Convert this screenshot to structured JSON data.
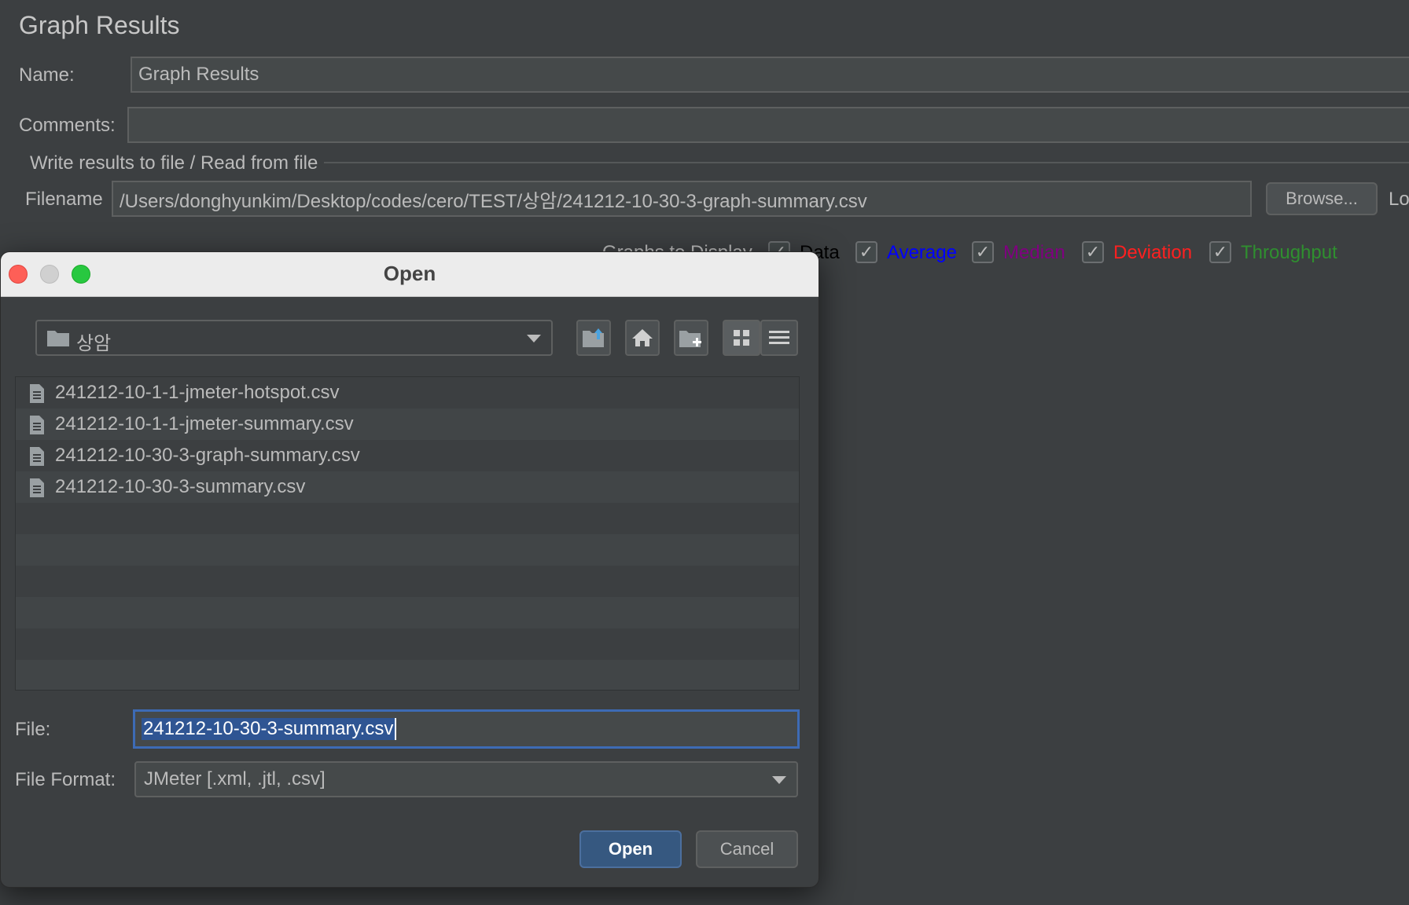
{
  "panel": {
    "title": "Graph Results",
    "name_label": "Name:",
    "name_value": "Graph Results",
    "comments_label": "Comments:",
    "comments_value": "",
    "group_title": "Write results to file / Read from file",
    "filename_label": "Filename",
    "filename_value": "/Users/donghyunkim/Desktop/codes/cero/TEST/상암/241212-10-30-3-graph-summary.csv",
    "browse_label": "Browse...",
    "log_label": "Lo",
    "graphs_label": "Graphs to Display",
    "graphs": [
      {
        "label": "Data",
        "color": "#000000",
        "checked": true
      },
      {
        "label": "Average",
        "color": "#0000ff",
        "checked": true
      },
      {
        "label": "Median",
        "color": "#800080",
        "checked": true
      },
      {
        "label": "Deviation",
        "color": "#ff2020",
        "checked": true
      },
      {
        "label": "Throughput",
        "color": "#2f8f2f",
        "checked": true
      }
    ]
  },
  "dialog": {
    "title": "Open",
    "folder": "상암",
    "toolbar_icons": [
      "up-folder-icon",
      "home-icon",
      "new-folder-icon",
      "grid-view-icon",
      "list-view-icon"
    ],
    "files": [
      "241212-10-1-1-jmeter-hotspot.csv",
      "241212-10-1-1-jmeter-summary.csv",
      "241212-10-30-3-graph-summary.csv",
      "241212-10-30-3-summary.csv"
    ],
    "file_label": "File:",
    "file_value": "241212-10-30-3-summary.csv",
    "format_label": "File Format:",
    "format_value": "JMeter [.xml, .jtl, .csv]",
    "open_label": "Open",
    "cancel_label": "Cancel"
  }
}
